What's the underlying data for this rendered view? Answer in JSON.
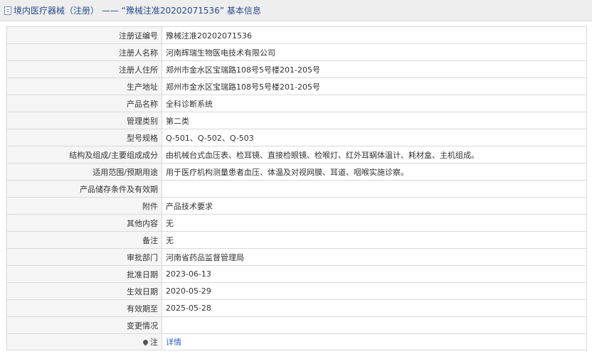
{
  "header": {
    "title": "境内医疗器械（注册） ——  “豫械注准20202071536” 基本信息",
    "icon": "document-icon"
  },
  "rows": [
    {
      "label": "注册证编号",
      "value": "豫械注准20202071536"
    },
    {
      "label": "注册人名称",
      "value": "河南辉瑞生物医电技术有限公司"
    },
    {
      "label": "注册人住所",
      "value": "郑州市金水区宝瑞路108号5号楼201-205号"
    },
    {
      "label": "生产地址",
      "value": "郑州市金水区宝瑞路108号5号楼201-205号"
    },
    {
      "label": "产品名称",
      "value": "全科诊断系统"
    },
    {
      "label": "管理类别",
      "value": "第二类"
    },
    {
      "label": "型号规格",
      "value": "Q-501、Q-502、Q-503"
    },
    {
      "label": "结构及组成/主要组成成分",
      "value": "由机械台式血压表、检耳镜、直接检眼镜、检喉灯、红外耳蜗体温计、耗材盒、主机组成。"
    },
    {
      "label": "适用范围/预期用途",
      "value": "用于医疗机构测量患者血压、体温及对视网膜、耳道、咽喉实施诊察。"
    },
    {
      "label": "产品储存条件及有效期",
      "value": ""
    },
    {
      "label": "附件",
      "value": "产品技术要求"
    },
    {
      "label": "其他内容",
      "value": "无"
    },
    {
      "label": "备注",
      "value": "无"
    },
    {
      "label": "审批部门",
      "value": "河南省药品监督管理局"
    },
    {
      "label": "批准日期",
      "value": "2023-06-13"
    },
    {
      "label": "生效日期",
      "value": "2020-05-29"
    },
    {
      "label": "有效期至",
      "value": "2025-05-28"
    },
    {
      "label": "变更情况",
      "value": ""
    }
  ],
  "note_row": {
    "icon": "pin-icon",
    "label": "注",
    "link_text": "详情"
  },
  "colors": {
    "title_text": "#2a4d8f",
    "link": "#2a62c9",
    "label_bg": "#f5f5f5",
    "border": "#d9d9d9"
  }
}
